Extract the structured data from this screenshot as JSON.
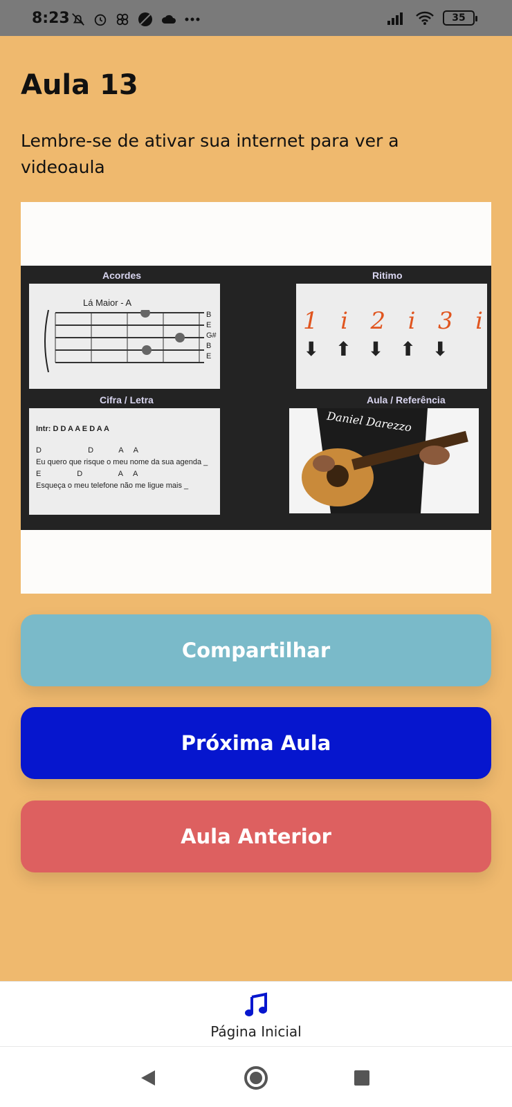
{
  "status_bar": {
    "time": "8:23",
    "battery": "35",
    "icons_left": [
      "bell-off-icon",
      "alarm-icon",
      "app-icon",
      "blocked-icon",
      "cloud-icon",
      "more-icon"
    ],
    "icons_right": [
      "signal-icon",
      "wifi-icon",
      "battery-icon"
    ]
  },
  "page": {
    "title": "Aula 13",
    "note": "Lembre-se de ativar sua internet  para ver a videoaula"
  },
  "video": {
    "labels": {
      "chords": "Acordes",
      "rhythm": "Ritimo",
      "cifra": "Cifra / Letra",
      "reference": "Aula / Referência"
    },
    "chord_name": "Lá Maior - A",
    "strings": [
      "B",
      "E",
      "G#",
      "B",
      "E"
    ],
    "rhythm": [
      "1",
      "i",
      "2",
      "i",
      "3",
      "i"
    ],
    "cifra_intro": "Intr: D  D  A  A  E  D  A  A",
    "cifra_line1_chords": "D                      D            A     A",
    "cifra_line1": "Eu quero que risque o meu nome da sua agenda  _",
    "cifra_line2_chords": "E                 D                 A     A",
    "cifra_line2": "Esqueça o meu telefone não me ligue mais   _",
    "photo_text": "Daniel Darezzo"
  },
  "buttons": {
    "share": "Compartilhar",
    "next": "Próxima Aula",
    "previous": "Aula Anterior"
  },
  "bottom_nav": {
    "home_label": "Página Inicial",
    "home_icon": "music-note-icon"
  },
  "colors": {
    "background": "#EFB96E",
    "share": "#7ABAC9",
    "next": "#0616CE",
    "previous": "#DD6060",
    "nav_icon": "#0616CE"
  }
}
